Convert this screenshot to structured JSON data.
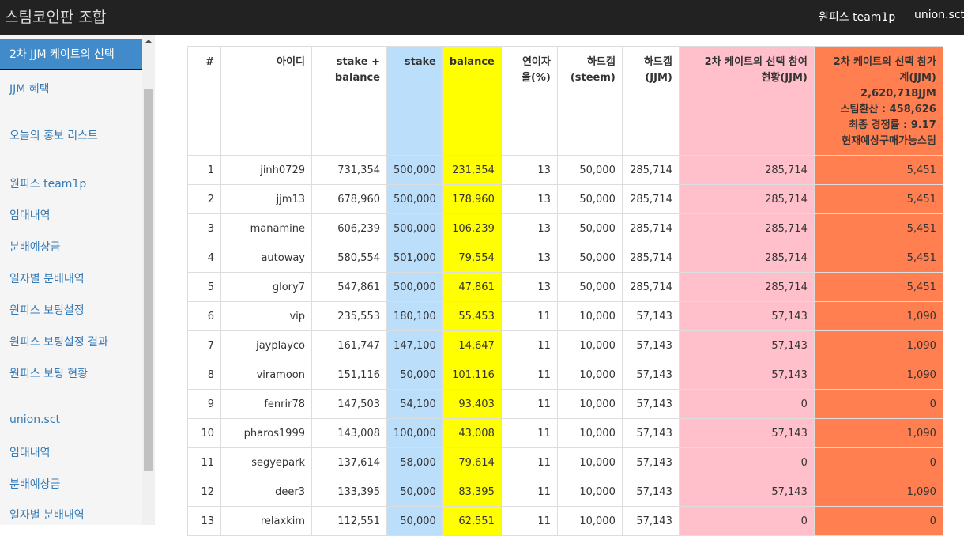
{
  "brand": "스팀코인판 조합",
  "nav": {
    "link1": "원피스 team1p",
    "link2": "union.sct"
  },
  "sidebar": {
    "items": [
      "2차 JJM 케이트의 선택",
      "JJM 혜택",
      "오늘의 홍보 리스트",
      "원피스 team1p",
      "임대내역",
      "분배예상금",
      "일자별 분배내역",
      "원피스 보팅설정",
      "원피스 보팅설정 결과",
      "원피스 보팅 현황",
      "union.sct",
      "임대내역",
      "분배예상금",
      "일자별 분배내역"
    ]
  },
  "colors": {
    "stake": "#bbdefb",
    "balance": "#ffff00",
    "pink": "#ffc0cb",
    "orange": "#ff7f50",
    "topbar": "#222222",
    "active": "#428bca"
  },
  "table": {
    "headers": {
      "num": "#",
      "id": "아이디",
      "total1": "stake +",
      "total2": "balance",
      "stake": "stake",
      "balance": "balance",
      "rate1": "연이자",
      "rate2": "율(%)",
      "cap_steem1": "하드캡",
      "cap_steem2": "(steem)",
      "cap_jjm1": "하드캡",
      "cap_jjm2": "(JJM)",
      "part1": "2차 케이트의 선택 참여",
      "part2": "현황(JJM)",
      "total_a": "2차 케이트의 선택 참가",
      "total_b": "계(JJM)",
      "total_c": "2,620,718JJM",
      "total_d": "스팀환산 : 458,626",
      "total_e": "최종 경쟁률 : 9.17",
      "total_f": "현재예상구매가능스팀"
    },
    "rows": [
      [
        "1",
        "jinh0729",
        "731,354",
        "500,000",
        "231,354",
        "13",
        "50,000",
        "285,714",
        "285,714",
        "5,451"
      ],
      [
        "2",
        "jjm13",
        "678,960",
        "500,000",
        "178,960",
        "13",
        "50,000",
        "285,714",
        "285,714",
        "5,451"
      ],
      [
        "3",
        "manamine",
        "606,239",
        "500,000",
        "106,239",
        "13",
        "50,000",
        "285,714",
        "285,714",
        "5,451"
      ],
      [
        "4",
        "autoway",
        "580,554",
        "501,000",
        "79,554",
        "13",
        "50,000",
        "285,714",
        "285,714",
        "5,451"
      ],
      [
        "5",
        "glory7",
        "547,861",
        "500,000",
        "47,861",
        "13",
        "50,000",
        "285,714",
        "285,714",
        "5,451"
      ],
      [
        "6",
        "vip",
        "235,553",
        "180,100",
        "55,453",
        "11",
        "10,000",
        "57,143",
        "57,143",
        "1,090"
      ],
      [
        "7",
        "jayplayco",
        "161,747",
        "147,100",
        "14,647",
        "11",
        "10,000",
        "57,143",
        "57,143",
        "1,090"
      ],
      [
        "8",
        "viramoon",
        "151,116",
        "50,000",
        "101,116",
        "11",
        "10,000",
        "57,143",
        "57,143",
        "1,090"
      ],
      [
        "9",
        "fenrir78",
        "147,503",
        "54,100",
        "93,403",
        "11",
        "10,000",
        "57,143",
        "0",
        "0"
      ],
      [
        "10",
        "pharos1999",
        "143,008",
        "100,000",
        "43,008",
        "11",
        "10,000",
        "57,143",
        "57,143",
        "1,090"
      ],
      [
        "11",
        "segyepark",
        "137,614",
        "58,000",
        "79,614",
        "11",
        "10,000",
        "57,143",
        "0",
        "0"
      ],
      [
        "12",
        "deer3",
        "133,395",
        "50,000",
        "83,395",
        "11",
        "10,000",
        "57,143",
        "57,143",
        "1,090"
      ],
      [
        "13",
        "relaxkim",
        "112,551",
        "50,000",
        "62,551",
        "11",
        "10,000",
        "57,143",
        "0",
        "0"
      ]
    ]
  }
}
